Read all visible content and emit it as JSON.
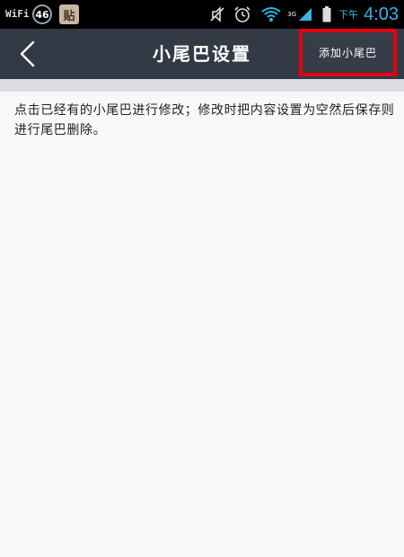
{
  "status_bar": {
    "wifi_label": "WiFi",
    "network_badge": "46",
    "paste_badge": "贴",
    "signal_label": "3G",
    "am_pm": "下午",
    "time": "4:03"
  },
  "header": {
    "title": "小尾巴设置",
    "add_button_label": "添加小尾巴"
  },
  "main": {
    "hint_text": "点击已经有的小尾巴进行修改；修改时把内容设置为空然后保存则进行尾巴删除。"
  },
  "colors": {
    "titlebar_bg": "#333a45",
    "highlight_border": "#e60010",
    "clock": "#33b5e5"
  }
}
